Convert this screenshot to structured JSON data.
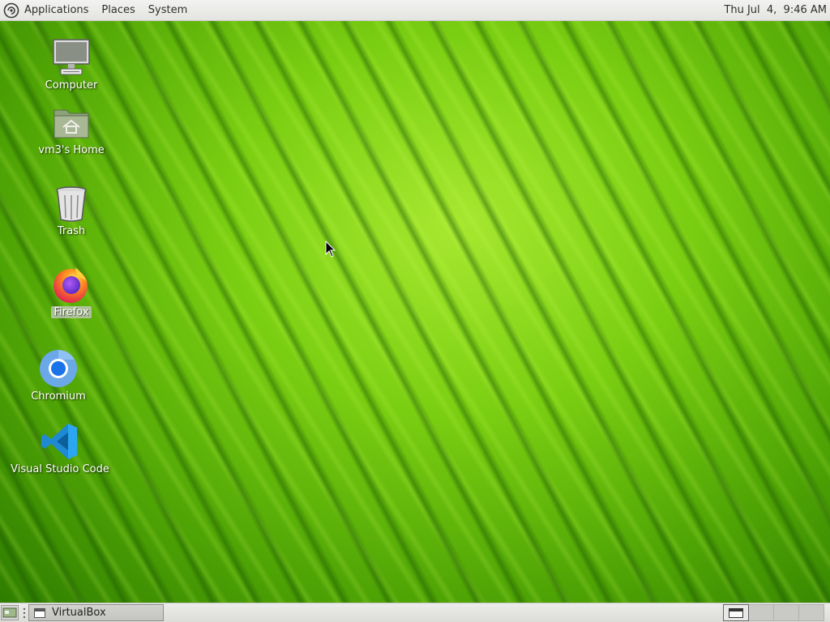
{
  "top_panel": {
    "menus": [
      "Applications",
      "Places",
      "System"
    ],
    "clock": "Thu Jul  4,  9:46 AM"
  },
  "desktop_icons": [
    {
      "label": "Computer",
      "icon": "computer-icon"
    },
    {
      "label": "vm3's Home",
      "icon": "home-folder-icon"
    },
    {
      "label": "Trash",
      "icon": "trash-icon"
    },
    {
      "label": "Firefox",
      "icon": "firefox-icon",
      "selected": true
    },
    {
      "label": "Chromium",
      "icon": "chromium-icon"
    },
    {
      "label": "Visual Studio Code",
      "icon": "vscode-icon"
    }
  ],
  "bottom_panel": {
    "tasks": [
      {
        "label": "VirtualBox",
        "icon": "window-icon"
      }
    ],
    "workspaces": 4,
    "active_workspace": 1
  },
  "colors": {
    "wallpaper": "#6cc21a",
    "panel": "#e6e6e3"
  }
}
